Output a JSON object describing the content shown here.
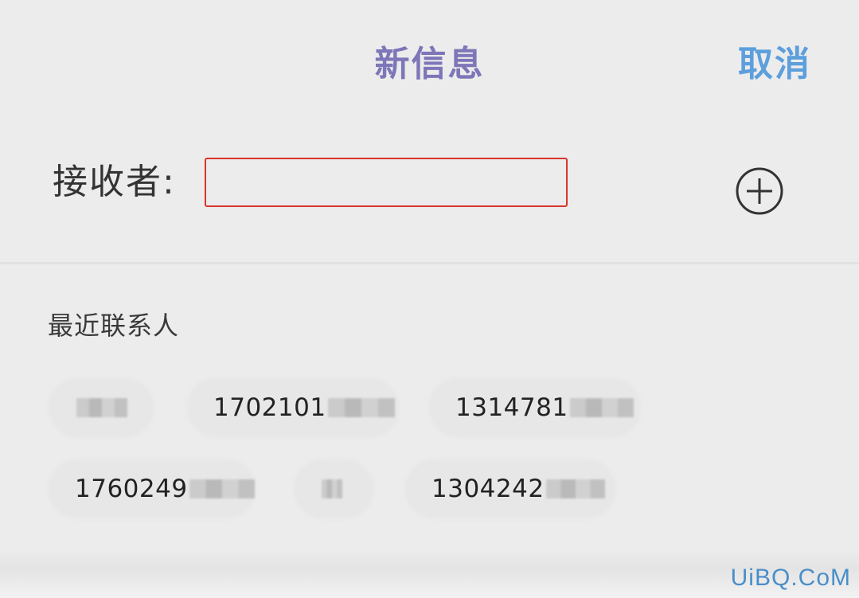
{
  "header": {
    "title": "新信息",
    "cancel_label": "取消"
  },
  "recipient": {
    "label": "接收者:",
    "value": "",
    "add_icon": "plus-circle-icon"
  },
  "recent": {
    "label": "最近联系人",
    "contacts": [
      "",
      "1702101",
      "1314781",
      "1760249",
      "",
      "1304242"
    ]
  },
  "watermark": "UiBQ.CoM",
  "colors": {
    "title": "#7d76b8",
    "cancel": "#5c9fdc",
    "input_border": "#d9352c",
    "background": "#ececec"
  }
}
